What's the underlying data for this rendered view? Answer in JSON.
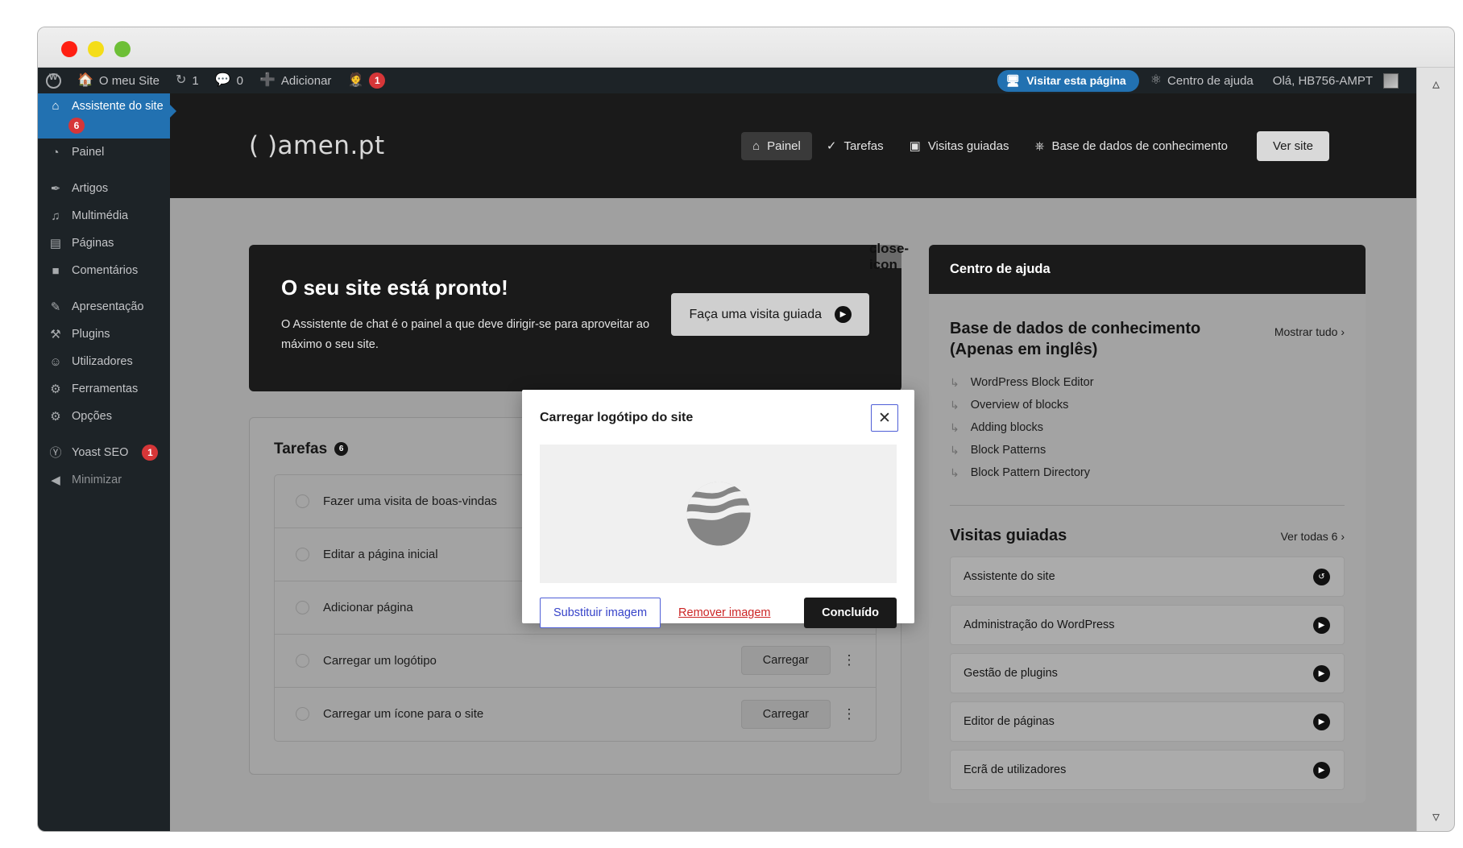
{
  "window": {
    "traffic_lights": [
      "close",
      "minimize",
      "maximize"
    ]
  },
  "adminbar": {
    "wp_logo": "wordpress-logo-icon",
    "site_name": "O meu Site",
    "updates_icon": "updates-icon",
    "updates_count": "1",
    "comments_icon": "comments-icon",
    "comments_count": "0",
    "add_icon": "plus-icon",
    "add_label": "Adicionar",
    "yoast_icon": "yoast-icon",
    "yoast_count": "1",
    "visit_page_icon": "screen-icon",
    "visit_page_label": "Visitar esta página",
    "help_icon": "help-icon",
    "help_label": "Centro de ajuda",
    "greeting": "Olá, HB756-AMPT",
    "avatar": "user-avatar"
  },
  "sidebar": {
    "items": [
      {
        "label": "Assistente do site",
        "icon": "home-icon",
        "badge": "6",
        "current": true,
        "gap_before": false,
        "dim": false
      },
      {
        "label": "Painel",
        "icon": "dashboard-icon",
        "badge": "",
        "current": false,
        "gap_before": false,
        "dim": false
      },
      {
        "label": "Artigos",
        "icon": "pin-icon",
        "badge": "",
        "current": false,
        "gap_before": true,
        "dim": false
      },
      {
        "label": "Multimédia",
        "icon": "media-icon",
        "badge": "",
        "current": false,
        "gap_before": false,
        "dim": false
      },
      {
        "label": "Páginas",
        "icon": "pages-icon",
        "badge": "",
        "current": false,
        "gap_before": false,
        "dim": false
      },
      {
        "label": "Comentários",
        "icon": "comment-icon",
        "badge": "",
        "current": false,
        "gap_before": false,
        "dim": false
      },
      {
        "label": "Apresentação",
        "icon": "appearance-icon",
        "badge": "",
        "current": false,
        "gap_before": true,
        "dim": false
      },
      {
        "label": "Plugins",
        "icon": "plugins-icon",
        "badge": "",
        "current": false,
        "gap_before": false,
        "dim": false
      },
      {
        "label": "Utilizadores",
        "icon": "users-icon",
        "badge": "",
        "current": false,
        "gap_before": false,
        "dim": false
      },
      {
        "label": "Ferramentas",
        "icon": "tools-icon",
        "badge": "",
        "current": false,
        "gap_before": false,
        "dim": false
      },
      {
        "label": "Opções",
        "icon": "settings-icon",
        "badge": "",
        "current": false,
        "gap_before": false,
        "dim": false
      },
      {
        "label": "Yoast SEO",
        "icon": "yoast-icon",
        "badge": "1",
        "current": false,
        "gap_before": true,
        "dim": false
      },
      {
        "label": "Minimizar",
        "icon": "collapse-icon",
        "badge": "",
        "current": false,
        "gap_before": false,
        "dim": true
      }
    ]
  },
  "amen_header": {
    "logo_text": "( )amen.pt",
    "nav": [
      {
        "label": "Painel",
        "icon": "home-icon",
        "active": true
      },
      {
        "label": "Tarefas",
        "icon": "check-circle-icon",
        "active": false
      },
      {
        "label": "Visitas guiadas",
        "icon": "screen-icon",
        "active": false
      },
      {
        "label": "Base de dados de conhecimento",
        "icon": "help-icon",
        "active": false
      }
    ],
    "view_site_label": "Ver site"
  },
  "hero": {
    "title": "O seu site está pronto!",
    "body": "O Assistente de chat é o painel a que deve dirigir-se para aproveitar ao máximo o seu site.",
    "tour_button": "Faça uma visita guiada",
    "tour_icon": "play-icon",
    "close_icon": "close-icon"
  },
  "tasks": {
    "title": "Tarefas",
    "count": "6",
    "rows": [
      {
        "label": "Fazer uma visita de boas-vindas",
        "action": "",
        "has_kebab": false
      },
      {
        "label": "Editar a página inicial",
        "action": "",
        "has_kebab": false
      },
      {
        "label": "Adicionar página",
        "action": "",
        "has_kebab": false
      },
      {
        "label": "Carregar um logótipo",
        "action": "Carregar",
        "has_kebab": true
      },
      {
        "label": "Carregar um ícone para o site",
        "action": "Carregar",
        "has_kebab": true
      }
    ]
  },
  "help_center": {
    "header": "Centro de ajuda",
    "kb_title": "Base de dados de conhecimento (Apenas em inglês)",
    "kb_show_all": "Mostrar tudo  ›",
    "kb_items": [
      "WordPress Block Editor",
      "Overview of blocks",
      "Adding blocks",
      "Block Patterns",
      "Block Pattern Directory"
    ],
    "tours_title": "Visitas guiadas",
    "tours_view_all": "Ver todas 6  ›",
    "tours": [
      {
        "label": "Assistente do site",
        "icon": "replay-icon"
      },
      {
        "label": "Administração do WordPress",
        "icon": "play-icon"
      },
      {
        "label": "Gestão de plugins",
        "icon": "play-icon"
      },
      {
        "label": "Editor de páginas",
        "icon": "play-icon"
      },
      {
        "label": "Ecrã de utilizadores",
        "icon": "play-icon"
      }
    ]
  },
  "modal": {
    "title": "Carregar logótipo do site",
    "close_icon": "close-icon",
    "preview_image": "site-logo-preview",
    "replace_label": "Substituir imagem",
    "remove_label": "Remover imagem",
    "done_label": "Concluído"
  },
  "scrollbar": {
    "up_icon": "chevron-up-icon",
    "down_icon": "chevron-down-icon"
  },
  "colors": {
    "wp_dark": "#1d2327",
    "wp_blue": "#2271b1",
    "badge_red": "#d63638",
    "amen_dark": "#1a1a1a",
    "modal_accent": "#4f5fd7",
    "danger_link": "#cc2525"
  }
}
